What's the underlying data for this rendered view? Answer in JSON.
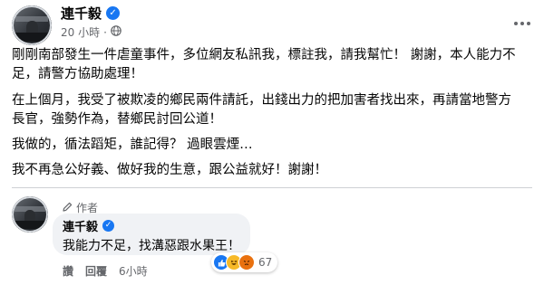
{
  "post": {
    "author": "連千毅",
    "time": "20 小時",
    "separator": "·",
    "paragraphs": [
      "剛剛南部發生一件虐童事件，多位網友私訊我，標註我，請我幫忙！ 謝謝，本人能力不足，請警方協助處理！",
      "在上個月，我受了被欺凌的鄉民兩件請託，出錢出力的把加害者找出來，再請當地警方長官，強勢作為，替鄉民討回公道！",
      "我做的，循法蹈矩，誰記得？ 過眼雲煙…",
      "我不再急公好義、做好我的生意，跟公益就好！謝謝！"
    ]
  },
  "comment": {
    "badge": "作者",
    "author": "連千毅",
    "text": "我能力不足，找溝惡跟水果王！",
    "reaction_count": "67",
    "like_action": "讚",
    "reply_action": "回覆",
    "time": "6小時"
  },
  "icons": {
    "verified": "verified-badge-icon",
    "globe": "globe-icon",
    "more": "more-options-icon",
    "pen": "pen-icon",
    "reactions": [
      "like-icon",
      "haha-icon",
      "angry-icon"
    ]
  },
  "colors": {
    "accent": "#1877f2",
    "secondary_text": "#65676b",
    "bubble": "#f0f2f5"
  }
}
